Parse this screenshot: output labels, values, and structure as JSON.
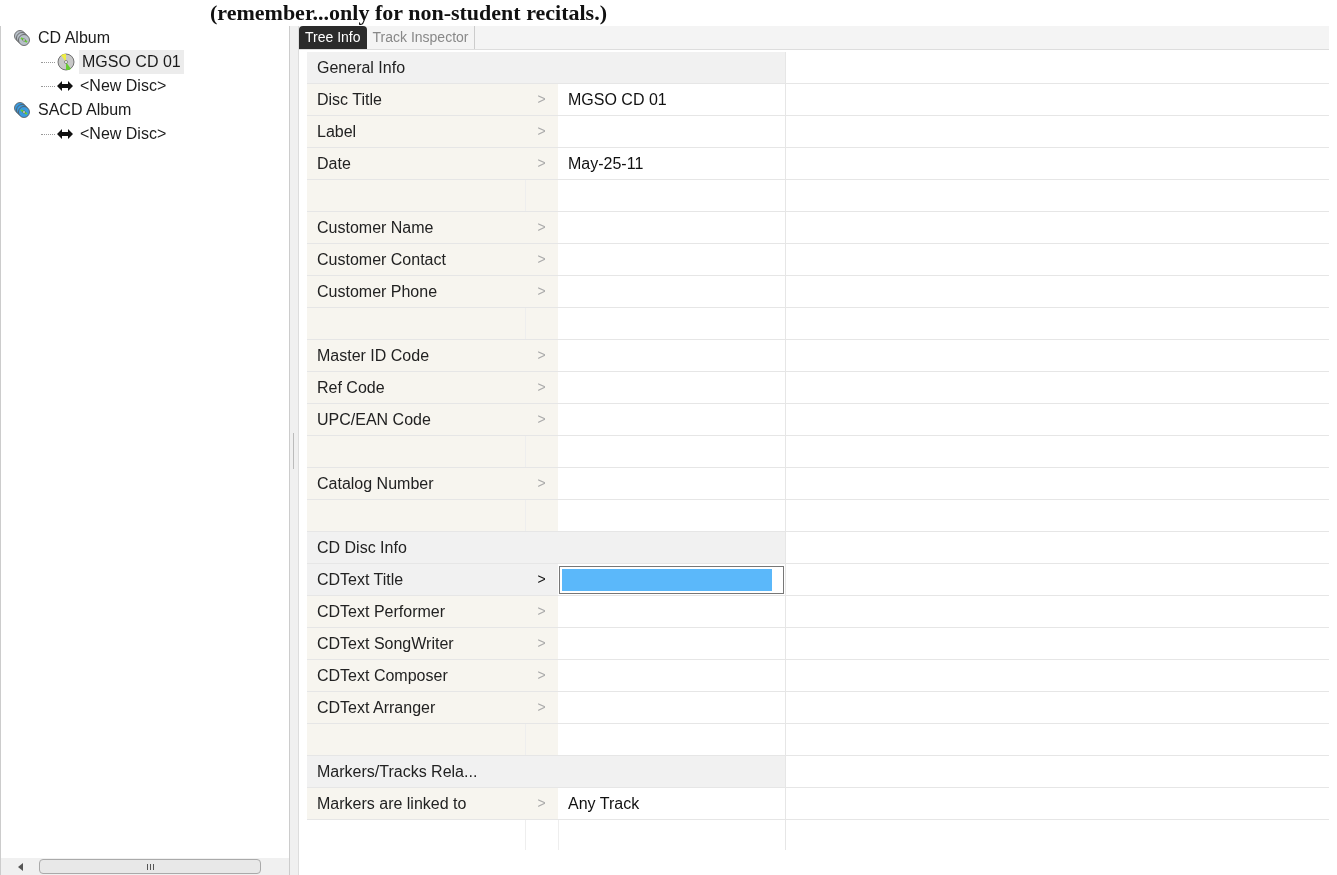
{
  "banner": {
    "text": "(remember...only for non-student recitals.)"
  },
  "tree": {
    "items": [
      {
        "label": "CD Album",
        "kind": "cd_album",
        "selected": false,
        "children": [
          {
            "label": "MGSO CD 01",
            "kind": "disc",
            "selected": true
          },
          {
            "label": "<New Disc>",
            "kind": "new_disc",
            "selected": false
          }
        ]
      },
      {
        "label": "SACD Album",
        "kind": "sacd_album",
        "selected": false,
        "children": [
          {
            "label": "<New Disc>",
            "kind": "new_disc",
            "selected": false
          }
        ]
      }
    ]
  },
  "tabs": [
    {
      "label": "Tree Info",
      "selected": true
    },
    {
      "label": "Track Inspector",
      "selected": false
    }
  ],
  "grid": {
    "rows": [
      {
        "kind": "section",
        "label": "General Info"
      },
      {
        "kind": "property",
        "label": "Disc Title",
        "arrow": ">",
        "value": "MGSO CD 01",
        "selected": false
      },
      {
        "kind": "property",
        "label": "Label",
        "arrow": ">",
        "selected": false
      },
      {
        "kind": "property",
        "label": "Date",
        "arrow": ">",
        "value": "May-25-11",
        "selected": false
      },
      {
        "kind": "spacer"
      },
      {
        "kind": "property",
        "label": "Customer Name",
        "arrow": ">",
        "selected": false
      },
      {
        "kind": "property",
        "label": "Customer Contact",
        "arrow": ">",
        "selected": false
      },
      {
        "kind": "property",
        "label": "Customer Phone",
        "arrow": ">",
        "selected": false
      },
      {
        "kind": "spacer"
      },
      {
        "kind": "property",
        "label": "Master ID Code",
        "arrow": ">",
        "selected": false
      },
      {
        "kind": "property",
        "label": "Ref Code",
        "arrow": ">",
        "selected": false
      },
      {
        "kind": "property",
        "label": "UPC/EAN Code",
        "arrow": ">",
        "selected": false
      },
      {
        "kind": "spacer"
      },
      {
        "kind": "property",
        "label": "Catalog Number",
        "arrow": ">",
        "selected": false
      },
      {
        "kind": "spacer"
      },
      {
        "kind": "section",
        "label": "CD Disc Info"
      },
      {
        "kind": "property",
        "label": "CDText Title",
        "arrow": ">",
        "selected": true
      },
      {
        "kind": "property",
        "label": "CDText Performer",
        "arrow": ">",
        "selected": false
      },
      {
        "kind": "property",
        "label": "CDText SongWriter",
        "arrow": ">",
        "selected": false
      },
      {
        "kind": "property",
        "label": "CDText Composer",
        "arrow": ">",
        "selected": false
      },
      {
        "kind": "property",
        "label": "CDText Arranger",
        "arrow": ">",
        "selected": false
      },
      {
        "kind": "spacer"
      },
      {
        "kind": "section",
        "label": "Markers/Tracks Rela..."
      },
      {
        "kind": "property",
        "label": "Markers are linked to",
        "arrow": ">",
        "value": "Any Track",
        "selected": false
      }
    ]
  }
}
